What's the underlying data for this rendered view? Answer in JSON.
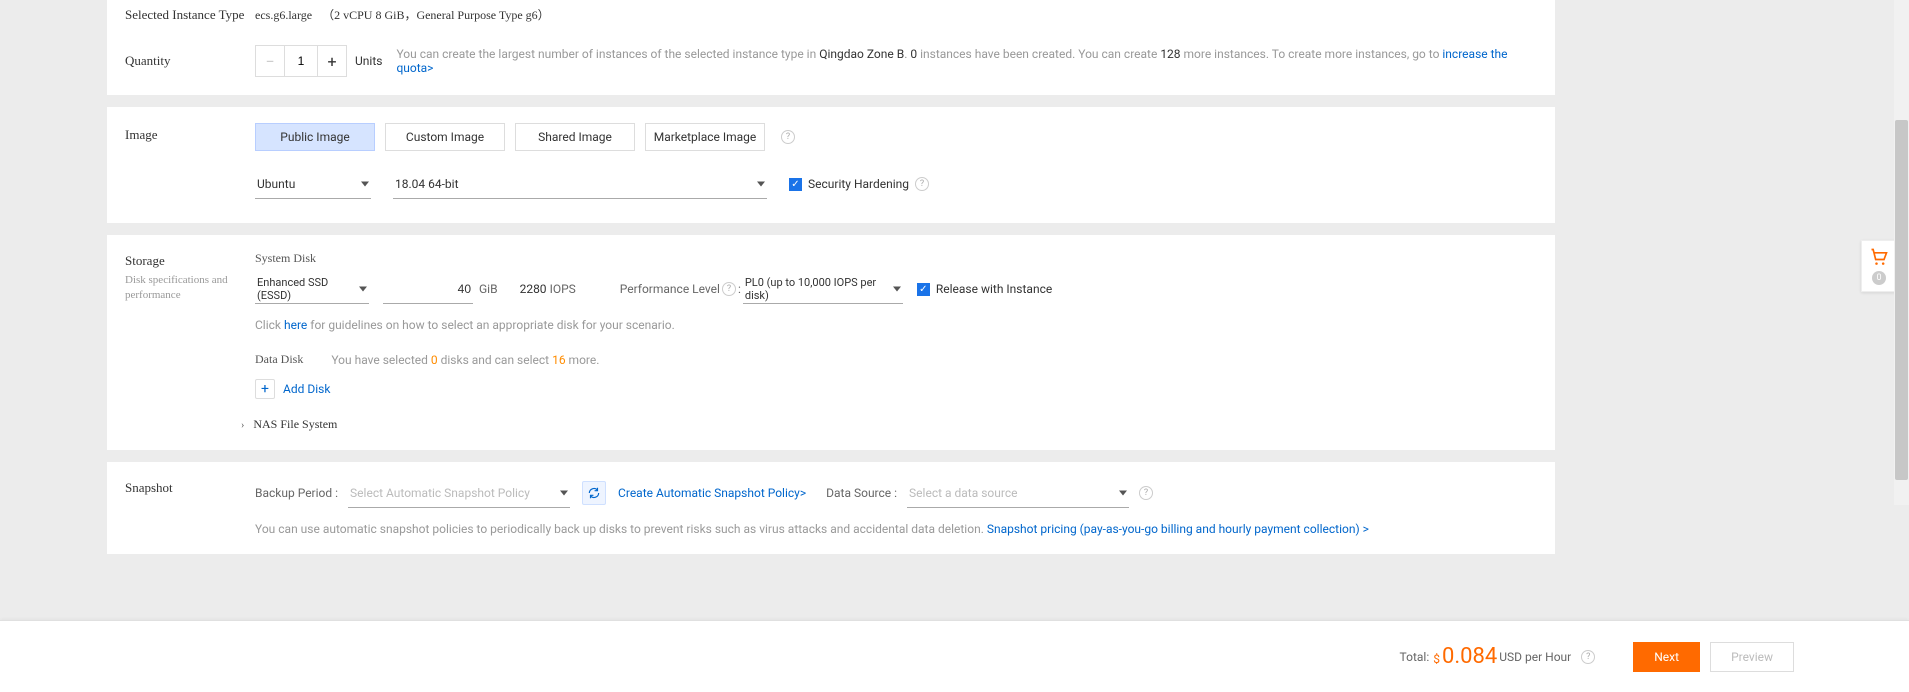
{
  "instance": {
    "label_type": "Selected Instance Type",
    "name": "ecs.g6.large",
    "spec": "（2 vCPU 8 GiB，General Purpose Type g6）"
  },
  "quantity": {
    "label": "Quantity",
    "value": "1",
    "units": "Units",
    "hint_prefix": "You can create the largest number of instances of the selected instance type in ",
    "hint_zone": "Qingdao Zone B",
    "hint_period": ". ",
    "hint_created_count": "0",
    "hint_created_suffix": " instances have been created. You can create ",
    "hint_max": "128",
    "hint_more": " more instances. To create more instances, go to ",
    "hint_link": "increase the quota>"
  },
  "image": {
    "label": "Image",
    "tabs": {
      "public": "Public Image",
      "custom": "Custom Image",
      "shared": "Shared Image",
      "marketplace": "Marketplace Image"
    },
    "os": "Ubuntu",
    "version": "18.04 64-bit",
    "security_hardening": "Security Hardening"
  },
  "storage": {
    "label": "Storage",
    "sublabel": "Disk specifications and performance",
    "system_disk_label": "System Disk",
    "disk_type": "Enhanced SSD (ESSD)",
    "size": "40",
    "size_unit": "GiB",
    "iops_val": "2280",
    "iops_suffix": "IOPS",
    "perf_level_label": "Performance Level",
    "perf_colon": ": ",
    "perf_value": "PL0 (up to 10,000 IOPS per disk)",
    "release_with_instance": "Release with Instance",
    "guideline_pre": "Click ",
    "guideline_link": "here",
    "guideline_post": " for guidelines on how to select an appropriate disk for your scenario.",
    "data_disk_label": "Data Disk",
    "data_disk_pre": "You have selected ",
    "data_disk_count": "0",
    "data_disk_mid": " disks and can select ",
    "data_disk_max": "16",
    "data_disk_post": " more.",
    "add_disk": "Add Disk",
    "nas": "NAS File System"
  },
  "snapshot": {
    "label": "Snapshot",
    "backup_period_label": "Backup Period :",
    "backup_placeholder": "Select Automatic Snapshot Policy",
    "create_link": "Create Automatic Snapshot Policy>",
    "data_source_label": "Data Source :",
    "data_source_placeholder": "Select a data source",
    "note_pre": "You can use automatic snapshot policies to periodically back up disks to prevent risks such as virus attacks and accidental data deletion. ",
    "note_link": "Snapshot pricing (pay-as-you-go billing and hourly payment collection) >"
  },
  "footer": {
    "total": "Total:",
    "currency": "$",
    "price": "0.084",
    "unit": "USD per Hour",
    "next": "Next",
    "preview": "Preview"
  },
  "cart": {
    "count": "0"
  }
}
